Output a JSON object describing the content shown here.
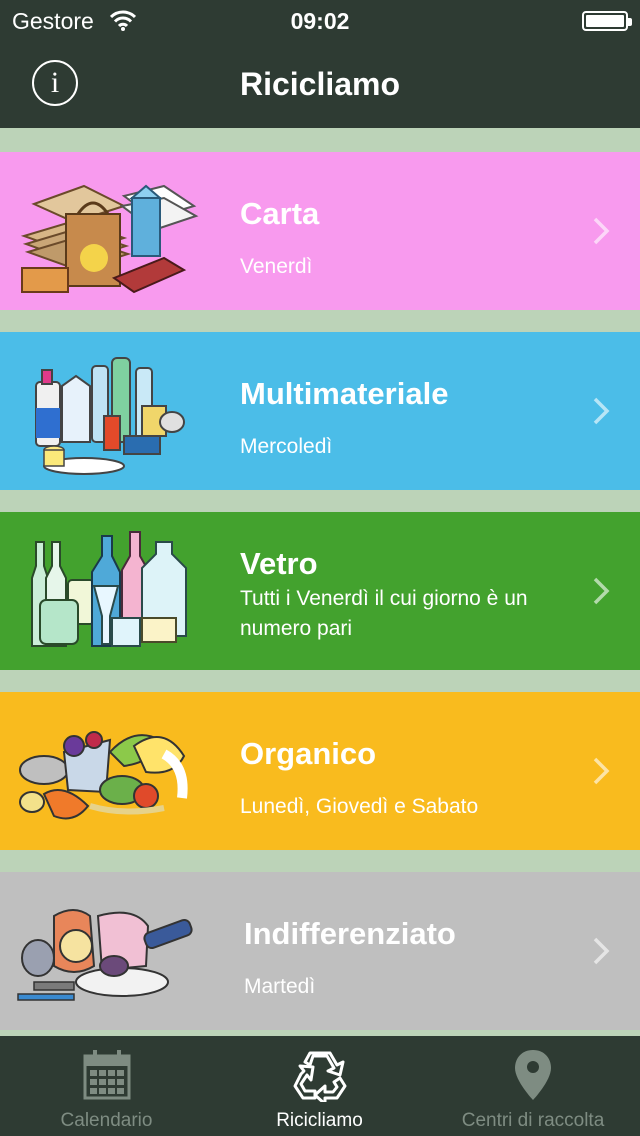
{
  "status_bar": {
    "carrier": "Gestore",
    "time": "09:02"
  },
  "navbar": {
    "info_glyph": "i",
    "title": "Ricicliamo"
  },
  "categories": [
    {
      "name": "Carta",
      "schedule": "Venerdì",
      "color": "#f89aee",
      "icon": "paper-waste-illustration"
    },
    {
      "name": "Multimateriale",
      "schedule": "Mercoledì",
      "color": "#4bbde8",
      "icon": "plastic-metal-waste-illustration"
    },
    {
      "name": "Vetro",
      "schedule": "Tutti i Venerdì il cui giorno è un numero pari",
      "color": "#43a22e",
      "icon": "glass-waste-illustration"
    },
    {
      "name": "Organico",
      "schedule": "Lunedì, Giovedì e Sabato",
      "color": "#f9bb1e",
      "icon": "organic-waste-illustration"
    },
    {
      "name": "Indifferenziato",
      "schedule": "Martedì",
      "color": "#bfbfbf",
      "icon": "mixed-waste-illustration"
    }
  ],
  "tabs": [
    {
      "label": "Calendario",
      "icon": "calendar-icon",
      "active": false
    },
    {
      "label": "Ricicliamo",
      "icon": "recycle-icon",
      "active": true
    },
    {
      "label": "Centri di raccolta",
      "icon": "map-pin-icon",
      "active": false
    }
  ],
  "colors": {
    "bar_background": "#2e3b33",
    "list_separator": "#bcd3b8",
    "tab_inactive": "#7e8c82",
    "tab_active": "#ffffff"
  }
}
